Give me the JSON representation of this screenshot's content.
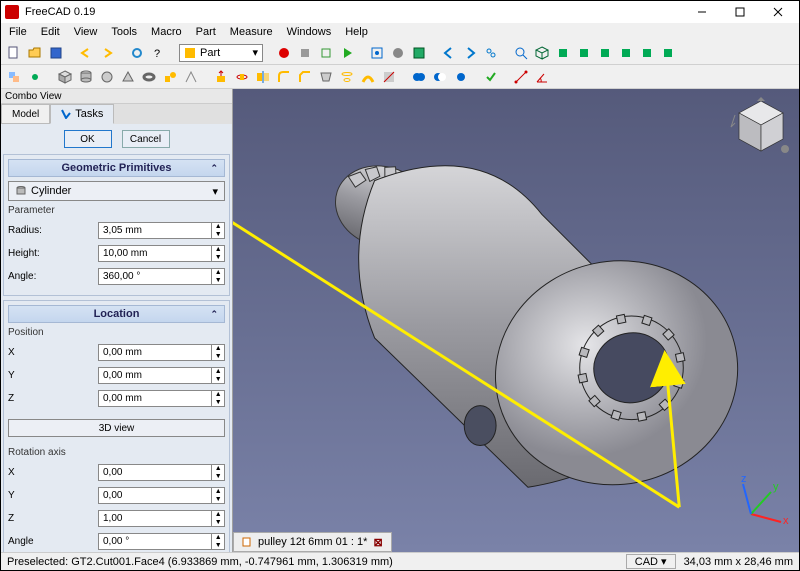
{
  "title": "FreeCAD 0.19",
  "menus": [
    "File",
    "Edit",
    "View",
    "Tools",
    "Macro",
    "Part",
    "Measure",
    "Windows",
    "Help"
  ],
  "workbench_selected": "Part",
  "combo_title": "Combo View",
  "tabs": {
    "model": "Model",
    "tasks": "Tasks"
  },
  "buttons": {
    "ok": "OK",
    "cancel": "Cancel"
  },
  "sections": {
    "primitives": "Geometric Primitives",
    "location": "Location"
  },
  "primitive_selected": "Cylinder",
  "prim_label": "Parameter",
  "radius": {
    "label": "Radius:",
    "value": "3,05 mm"
  },
  "height": {
    "label": "Height:",
    "value": "10,00 mm"
  },
  "angle": {
    "label": "Angle:",
    "value": "360,00 °"
  },
  "position_label": "Position",
  "pos_x": {
    "label": "X",
    "value": "0,00 mm"
  },
  "pos_y": {
    "label": "Y",
    "value": "0,00 mm"
  },
  "pos_z": {
    "label": "Z",
    "value": "0,00 mm"
  },
  "view3d": "3D view",
  "rot_label": "Rotation axis",
  "rot_x": {
    "label": "X",
    "value": "0,00"
  },
  "rot_y": {
    "label": "Y",
    "value": "0,00"
  },
  "rot_z": {
    "label": "Z",
    "value": "1,00"
  },
  "rot_a": {
    "label": "Angle",
    "value": "0,00 °"
  },
  "doc_tab": "pulley 12t 6mm 01 : 1*",
  "status_left": "Preselected: GT2.Cut001.Face4 (6.933869 mm, -0.747961 mm, 1.306319 mm)",
  "status_nav": "CAD",
  "status_dim": "34,03 mm x 28,46 mm"
}
